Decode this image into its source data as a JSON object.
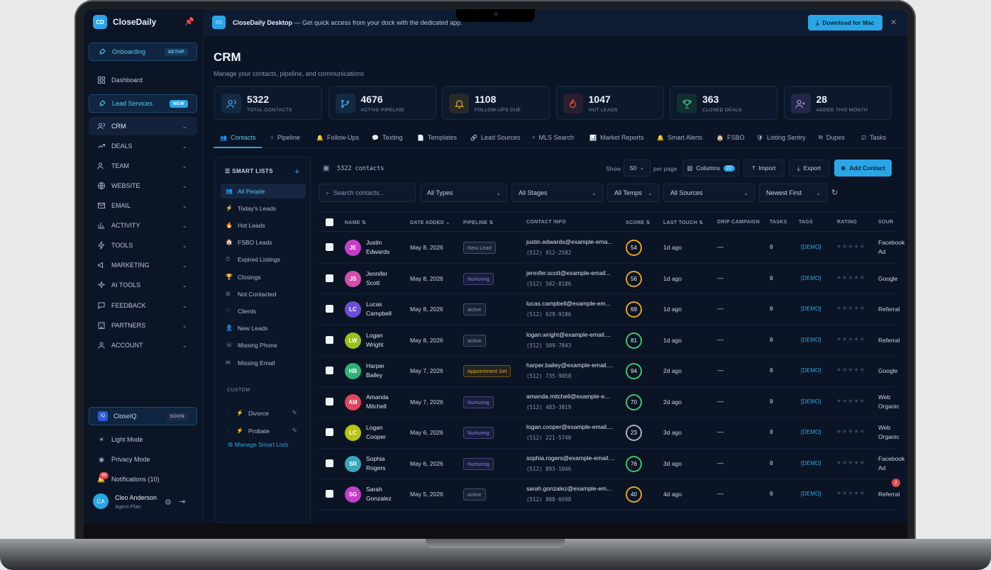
{
  "sidebar": {
    "logo": "CD",
    "app_name": "CloseDaily",
    "items": [
      {
        "label": "Onboarding",
        "badge": "SETUP",
        "icon": "rocket-icon"
      },
      {
        "label": "Dashboard",
        "icon": "grid-icon"
      },
      {
        "label": "Lead Services",
        "badge": "NEW",
        "icon": "rocket-icon"
      },
      {
        "label": "CRM",
        "icon": "users-icon"
      },
      {
        "label": "DEALS",
        "icon": "trend-icon"
      },
      {
        "label": "TEAM",
        "icon": "team-icon"
      },
      {
        "label": "WEBSITE",
        "icon": "globe-icon"
      },
      {
        "label": "EMAIL",
        "icon": "mail-icon"
      },
      {
        "label": "ACTIVITY",
        "icon": "chart-icon"
      },
      {
        "label": "TOOLS",
        "icon": "bolt-icon"
      },
      {
        "label": "MARKETING",
        "icon": "megaphone-icon"
      },
      {
        "label": "AI TOOLS",
        "icon": "sparkle-icon"
      },
      {
        "label": "FEEDBACK",
        "icon": "message-icon"
      },
      {
        "label": "PARTNERS",
        "icon": "building-icon"
      },
      {
        "label": "ACCOUNT",
        "icon": "user-icon"
      }
    ],
    "closeiq": {
      "logo": "IQ",
      "label": "CloseIQ",
      "badge": "SOON"
    },
    "light_mode": "Light Mode",
    "privacy_mode": "Privacy Mode",
    "notifications": "Notifications (10)",
    "notif_count": "99",
    "user": {
      "initials": "CA",
      "name": "Cleo Anderson",
      "role": "Agent Plan"
    }
  },
  "banner": {
    "title": "CloseDaily Desktop",
    "text": " — Get quick access from your dock with the dedicated app.",
    "download": "Download for Mac"
  },
  "page": {
    "title": "CRM",
    "subtitle": "Manage your contacts, pipeline, and communications"
  },
  "stats": [
    {
      "value": "5322",
      "label": "TOTAL CONTACTS",
      "color": "#4aa3d8"
    },
    {
      "value": "4676",
      "label": "ACTIVE PIPELINE",
      "color": "#4aa3d8"
    },
    {
      "value": "1108",
      "label": "FOLLOW-UPS DUE",
      "color": "#e0a61c"
    },
    {
      "value": "1047",
      "label": "HOT LEADS",
      "color": "#e5533d"
    },
    {
      "value": "363",
      "label": "CLOSED DEALS",
      "color": "#3ec46d"
    },
    {
      "value": "28",
      "label": "ADDED THIS MONTH",
      "color": "#a98bf0"
    }
  ],
  "tabs": [
    "Contacts",
    "Pipeline",
    "Follow-Ups",
    "Texting",
    "Templates",
    "Lead Sources",
    "MLS Search",
    "Market Reports",
    "Smart Alerts",
    "FSBO",
    "Listing Sentry",
    "Dupes",
    "Tasks"
  ],
  "smart_lists": {
    "title": "SMART LISTS",
    "items": [
      "All People",
      "Today's Leads",
      "Hot Leads",
      "FSBO Leads",
      "Expired Listings",
      "Closings",
      "Not Contacted",
      "Clients",
      "New Leads",
      "Missing Phone",
      "Missing Email"
    ],
    "custom_title": "CUSTOM",
    "custom": [
      "Divorce",
      "Probate"
    ],
    "manage": "Manage Smart Lists"
  },
  "toolbar": {
    "count": "5322 contacts",
    "show": "Show",
    "per_page_value": "50",
    "per_page": "per page",
    "columns": "Columns",
    "columns_count": "22",
    "import": "Import",
    "export": "Export",
    "add": "Add Contact"
  },
  "filters": {
    "search_placeholder": "Search contacts...",
    "types": "All Types",
    "stages": "All Stages",
    "temps": "All Temps",
    "sources": "All Sources",
    "sort": "Newest First"
  },
  "columns": [
    "NAME",
    "DATE ADDED",
    "PIPELINE",
    "CONTACT INFO",
    "SCORE",
    "LAST TOUCH",
    "DRIP CAMPAIGN",
    "TASKS",
    "TAGS",
    "RATING",
    "SOUR"
  ],
  "contacts": [
    {
      "initials": "JE",
      "first": "Justin",
      "last": "Edwards",
      "date": "May 8, 2026",
      "stage": "New Lead",
      "email": "justin.edwards@example-ema...",
      "phone": "(512) 912-2582",
      "score": "54",
      "touch": "1d ago",
      "drip": "—",
      "tasks": "0",
      "tag": "[DEMO]",
      "src1": "Facebook",
      "src2": "Ad",
      "avatar": "#c43fc9",
      "stage_color": "#8797b1",
      "score_color": "#e0a61c"
    },
    {
      "initials": "JS",
      "first": "Jennifer",
      "last": "Scott",
      "date": "May 8, 2026",
      "stage": "Nurturing",
      "email": "jennifer.scott@example-email...",
      "phone": "(512) 502-8186",
      "score": "56",
      "touch": "1d ago",
      "drip": "—",
      "tasks": "0",
      "tag": "[DEMO]",
      "src1": "Google",
      "src2": "",
      "avatar": "#d24fa8",
      "stage_color": "#8a7ae8",
      "score_color": "#e0a61c"
    },
    {
      "initials": "LC",
      "first": "Lucas",
      "last": "Campbell",
      "date": "May 8, 2026",
      "stage": "active",
      "email": "lucas.campbell@example-em...",
      "phone": "(512) 629-9186",
      "score": "69",
      "touch": "1d ago",
      "drip": "—",
      "tasks": "0",
      "tag": "[DEMO]",
      "src1": "Referral",
      "src2": "",
      "avatar": "#6b4fd6",
      "stage_color": "#8797b1",
      "score_color": "#e0a61c"
    },
    {
      "initials": "LW",
      "first": "Logan",
      "last": "Wright",
      "date": "May 8, 2026",
      "stage": "active",
      "email": "logan.wright@example-email....",
      "phone": "(512) 509-7843",
      "score": "81",
      "touch": "1d ago",
      "drip": "—",
      "tasks": "0",
      "tag": "[DEMO]",
      "src1": "Referral",
      "src2": "",
      "avatar": "#9cbf1e",
      "stage_color": "#8797b1",
      "score_color": "#3ec46d"
    },
    {
      "initials": "HB",
      "first": "Harper",
      "last": "Bailey",
      "date": "May 7, 2026",
      "stage": "Appointment Set",
      "email": "harper.bailey@example-email....",
      "phone": "(512) 735-9058",
      "score": "94",
      "touch": "2d ago",
      "drip": "—",
      "tasks": "0",
      "tag": "[DEMO]",
      "src1": "Google",
      "src2": "",
      "avatar": "#2fb27a",
      "stage_color": "#e0a61c",
      "score_color": "#3ec46d"
    },
    {
      "initials": "AM",
      "first": "Amanda",
      "last": "Mitchell",
      "date": "May 7, 2026",
      "stage": "Nurturing",
      "email": "amanda.mitchell@example-e...",
      "phone": "(512) 483-3819",
      "score": "70",
      "touch": "2d ago",
      "drip": "—",
      "tasks": "0",
      "tag": "[DEMO]",
      "src1": "Web",
      "src2": "Organic",
      "avatar": "#e0455a",
      "stage_color": "#8a7ae8",
      "score_color": "#3ec46d"
    },
    {
      "initials": "LC",
      "first": "Logan",
      "last": "Cooper",
      "date": "May 6, 2026",
      "stage": "Nurturing",
      "email": "logan.cooper@example-email....",
      "phone": "(512) 221-5740",
      "score": "23",
      "touch": "3d ago",
      "drip": "—",
      "tasks": "0",
      "tag": "[DEMO]",
      "src1": "Web",
      "src2": "Organic",
      "avatar": "#b8c414",
      "stage_color": "#8a7ae8",
      "score_color": "#a8b2c4"
    },
    {
      "initials": "SR",
      "first": "Sophia",
      "last": "Rogers",
      "date": "May 6, 2026",
      "stage": "Nurturing",
      "email": "sophia.rogers@example-email....",
      "phone": "(512) 893-1046",
      "score": "76",
      "touch": "3d ago",
      "drip": "—",
      "tasks": "0",
      "tag": "[DEMO]",
      "src1": "Facebook",
      "src2": "Ad",
      "avatar": "#3aa6b8",
      "stage_color": "#8a7ae8",
      "score_color": "#3ec46d"
    },
    {
      "initials": "SG",
      "first": "Sarah",
      "last": "Gonzalez",
      "date": "May 5, 2026",
      "stage": "active",
      "email": "sarah.gonzalez@example-em...",
      "phone": "(512) 808-6698",
      "score": "40",
      "touch": "4d ago",
      "drip": "—",
      "tasks": "0",
      "tag": "[DEMO]",
      "src1": "Referral",
      "src2": "",
      "avatar": "#c43fc9",
      "stage_color": "#8797b1",
      "score_color": "#e0a61c"
    }
  ],
  "chat_badge": "2"
}
